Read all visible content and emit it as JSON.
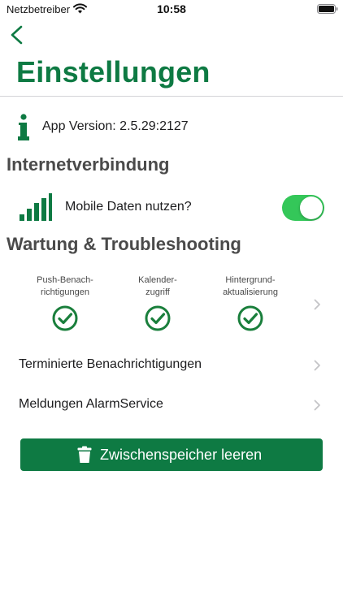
{
  "status_bar": {
    "carrier": "Netzbetreiber",
    "time": "10:58"
  },
  "header": {
    "back_icon": "chevron-left-icon",
    "title": "Einstellungen"
  },
  "app_info": {
    "icon": "info-icon",
    "version_text": "App Version: 2.5.29:2127"
  },
  "internet": {
    "heading": "Internetverbindung",
    "mobile_data_label": "Mobile Daten nutzen?",
    "mobile_data_enabled": true
  },
  "maintenance": {
    "heading": "Wartung & Troubleshooting",
    "permissions": [
      {
        "line1": "Push-Benach-",
        "line2": "richtigungen",
        "status": "ok"
      },
      {
        "line1": "Kalender-",
        "line2": "zugriff",
        "status": "ok"
      },
      {
        "line1": "Hintergrund-",
        "line2": "aktualisierung",
        "status": "ok"
      }
    ],
    "rows": [
      {
        "label": "Terminierte Benachrichtigungen"
      },
      {
        "label": "Meldungen AlarmService"
      }
    ],
    "clear_cache_label": "Zwischenspeicher leeren"
  },
  "colors": {
    "brand_green": "#0e7a43",
    "toggle_green": "#34c759",
    "check_green": "#1a7f3c",
    "heading_gray": "#4a4a4a"
  }
}
